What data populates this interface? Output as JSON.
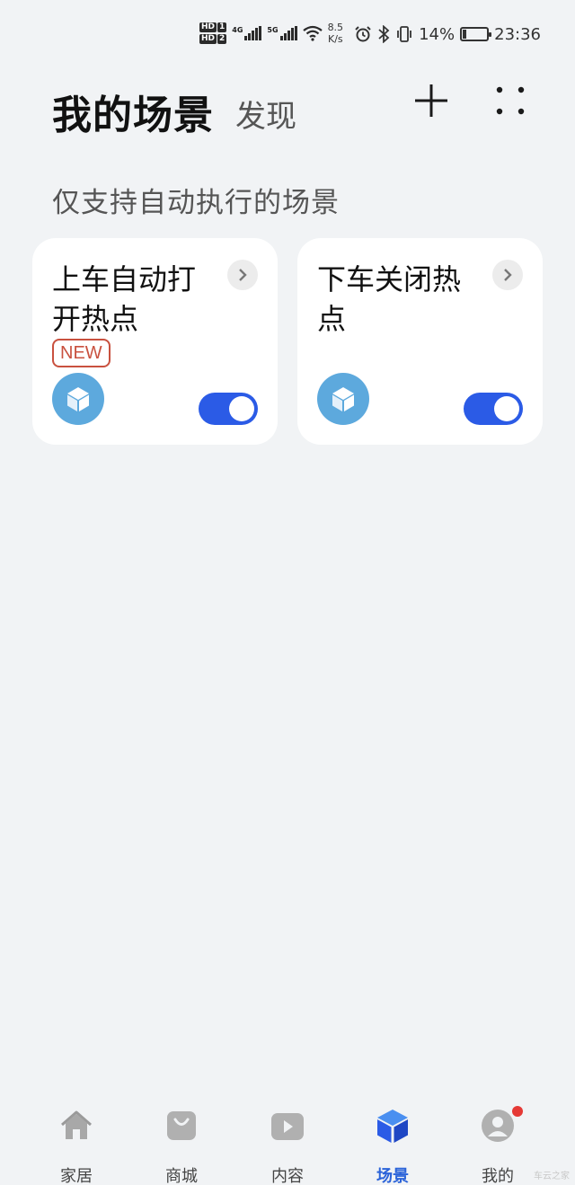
{
  "status_bar": {
    "hd1": "HD",
    "hd1_num": "1",
    "hd2": "HD",
    "hd2_num": "2",
    "net1": "4G",
    "net2": "5G",
    "speed_value": "8.5",
    "speed_unit": "K/s",
    "battery": "14%",
    "battery_level": 0.14,
    "time": "23:36"
  },
  "header": {
    "title": "我的场景",
    "discover_tab": "发现"
  },
  "section_label": "仅支持自动执行的场景",
  "scenes": [
    {
      "title": "上车自动打开热点",
      "badge": "NEW",
      "enabled": true
    },
    {
      "title": "下车关闭热点",
      "enabled": true
    }
  ],
  "bottom_nav": [
    {
      "label": "家居",
      "icon": "home-icon"
    },
    {
      "label": "商城",
      "icon": "shopping-bag-icon"
    },
    {
      "label": "内容",
      "icon": "play-icon"
    },
    {
      "label": "场景",
      "icon": "scene-cube-icon",
      "active": true
    },
    {
      "label": "我的",
      "icon": "profile-icon",
      "notification": true
    }
  ],
  "colors": {
    "accent": "#2b5be6",
    "scene_icon_bg": "#5da9dd",
    "badge_red": "#c9513f",
    "background": "#f1f3f5"
  },
  "watermark": "车云之家"
}
